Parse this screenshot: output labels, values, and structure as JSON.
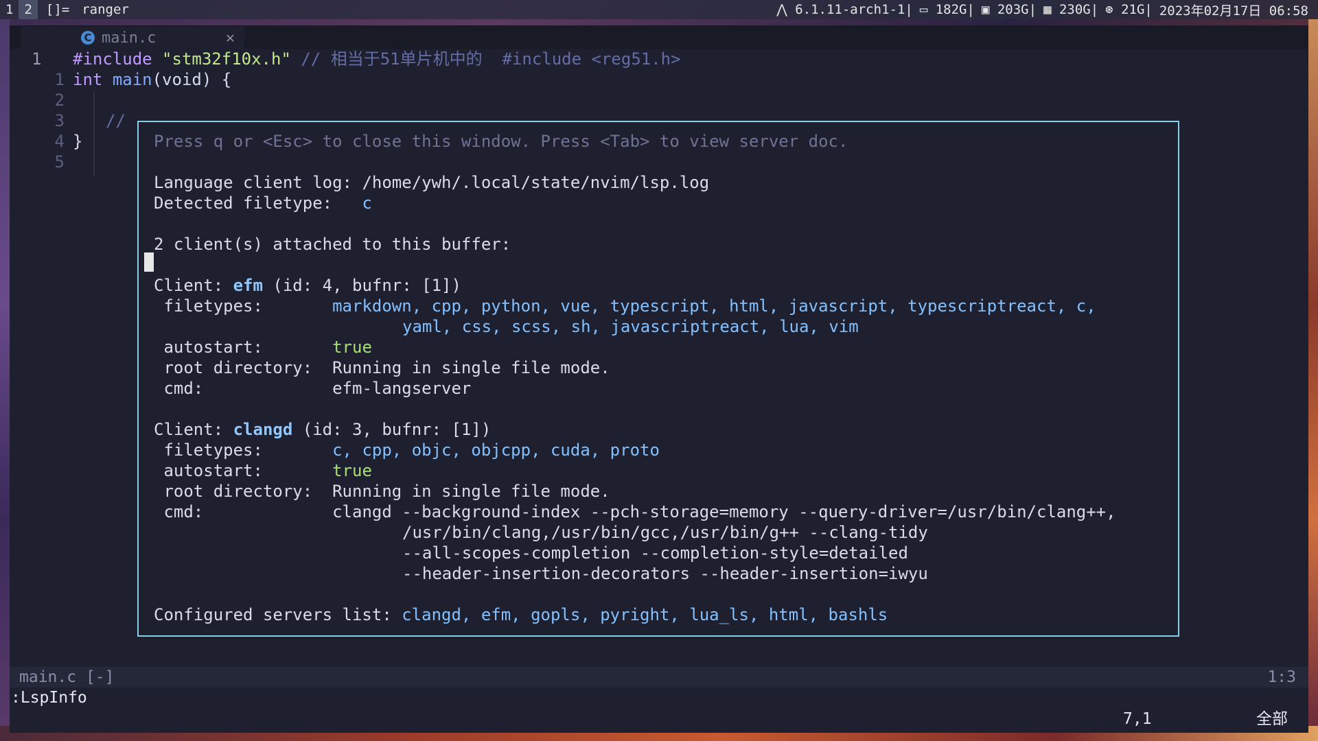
{
  "topbar": {
    "workspaces": [
      "1",
      "2"
    ],
    "active_workspace": "2",
    "layout": "[]=",
    "window_title": "ranger",
    "kernel": "6.1.11-arch1-1",
    "disk1": "182G",
    "disk2": "203G",
    "disk3": "230G",
    "disk4": "21G",
    "datetime": "2023年02月17日 06:58"
  },
  "tab": {
    "filename": "main.c",
    "icon": "c-file-icon",
    "close": "✕"
  },
  "editor": {
    "lines": [
      {
        "num": "1",
        "current": true
      },
      {
        "num": "1"
      },
      {
        "num": "2"
      },
      {
        "num": "3"
      },
      {
        "num": "4"
      },
      {
        "num": "5"
      }
    ],
    "line1_include": "#include",
    "line1_header": "\"stm32f10x.h\"",
    "line1_comment": "// 相当于51单片机中的  #include <reg51.h>",
    "line2_type": "int",
    "line2_func": "main",
    "line2_rest": "(void) {",
    "line4_comment": "//",
    "line5_brace": "}"
  },
  "lspinfo": {
    "hint": "Press q or <Esc> to close this window. Press <Tab> to view server doc.",
    "log_label": "Language client log: ",
    "log_path": "/home/ywh/.local/state/nvim/lsp.log",
    "filetype_label": "Detected filetype:   ",
    "filetype": "c",
    "clients_attached": "2 client(s) attached to this buffer:",
    "clients": [
      {
        "prefix": "Client: ",
        "name": "efm",
        "meta": " (id: 4, bufnr: [1])",
        "filetypes_label": " filetypes:       ",
        "filetypes_line1": "markdown, cpp, python, vue, typescript, html, javascript, typescriptreact, c,",
        "filetypes_line2": "yaml, css, scss, sh, javascriptreact, lua, vim",
        "autostart_label": " autostart:       ",
        "autostart": "true",
        "root_label": " root directory:  ",
        "root": "Running in single file mode.",
        "cmd_label": " cmd:             ",
        "cmd_lines": [
          "efm-langserver"
        ]
      },
      {
        "prefix": "Client: ",
        "name": "clangd",
        "meta": " (id: 3, bufnr: [1])",
        "filetypes_label": " filetypes:       ",
        "filetypes_line1": "c, cpp, objc, objcpp, cuda, proto",
        "autostart_label": " autostart:       ",
        "autostart": "true",
        "root_label": " root directory:  ",
        "root": "Running in single file mode.",
        "cmd_label": " cmd:             ",
        "cmd_lines": [
          "clangd --background-index --pch-storage=memory --query-driver=/usr/bin/clang++,",
          "/usr/bin/clang,/usr/bin/gcc,/usr/bin/g++ --clang-tidy",
          "--all-scopes-completion --completion-style=detailed",
          "--header-insertion-decorators --header-insertion=iwyu"
        ]
      }
    ],
    "configured_label": "Configured servers list: ",
    "configured": "clangd, efm, gopls, pyright, lua_ls, html, bashls"
  },
  "statusline": {
    "file": "main.c [-]",
    "position": "1:3"
  },
  "cmdline": ":LspInfo",
  "ruler": {
    "position": "7,1",
    "scroll": "全部"
  }
}
